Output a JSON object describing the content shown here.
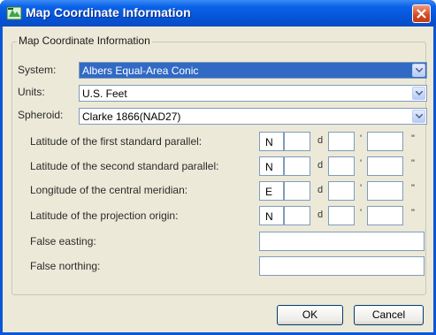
{
  "window": {
    "title": "Map Coordinate Information",
    "icon": "map-app-icon",
    "close_icon": "close-icon"
  },
  "group": {
    "label": "Map Coordinate Information"
  },
  "system": {
    "label": "System:",
    "value": "Albers Equal-Area Conic"
  },
  "units": {
    "label": "Units:",
    "value": "U.S. Feet"
  },
  "spheroid": {
    "label": "Spheroid:",
    "value": "Clarke 1866(NAD27)"
  },
  "parallels": [
    {
      "label": "Latitude of the first standard parallel:",
      "direction": "N"
    },
    {
      "label": "Latitude of the second standard parallel:",
      "direction": "N"
    },
    {
      "label": "Longitude of the central meridian:",
      "direction": "E"
    },
    {
      "label": "Latitude of the projection origin:",
      "direction": "N"
    }
  ],
  "units_symbols": {
    "degrees": "d",
    "minutes": "'",
    "seconds": "\""
  },
  "false_easting": {
    "label": "False easting:",
    "value": ""
  },
  "false_northing": {
    "label": "False northing:",
    "value": ""
  },
  "buttons": {
    "ok": "OK",
    "cancel": "Cancel"
  },
  "colors": {
    "title_bar": "#0553d6",
    "dialog_bg": "#ece9d8",
    "selection": "#316ac5",
    "close_button": "#d3481f"
  }
}
